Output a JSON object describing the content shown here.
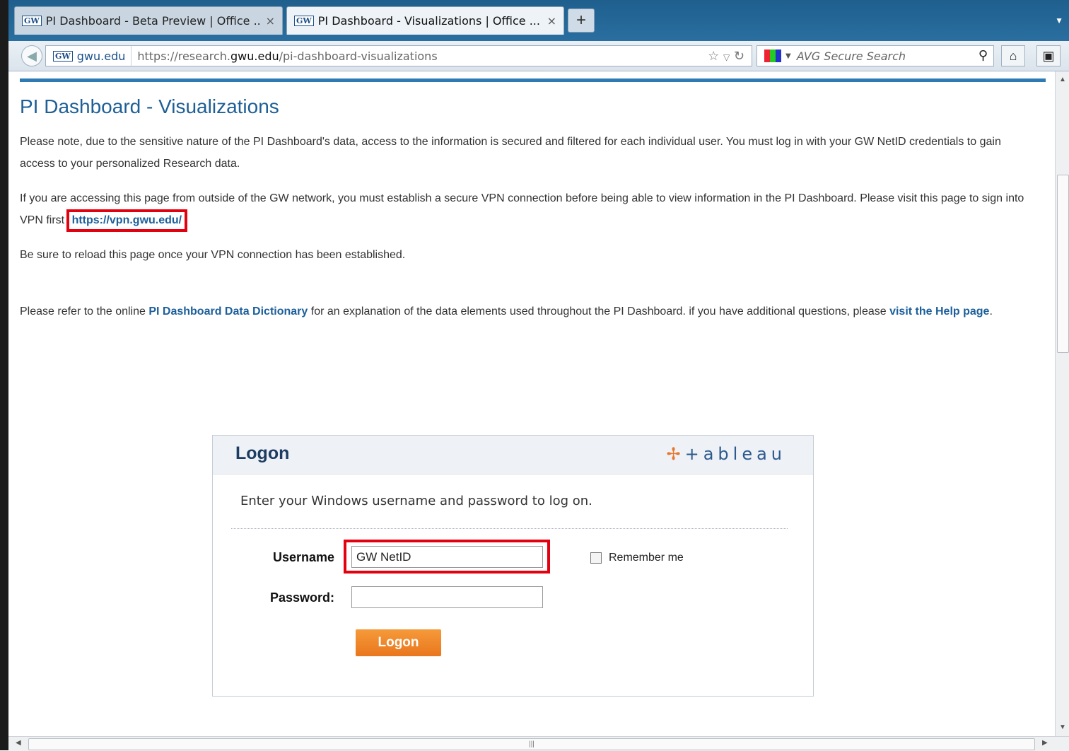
{
  "browser": {
    "tabs": [
      {
        "favicon": "GW",
        "title": "PI Dashboard - Beta Preview | Office ...",
        "close": "×"
      },
      {
        "favicon": "GW",
        "title": "PI Dashboard - Visualizations | Office ...",
        "close": "×"
      }
    ],
    "new_tab": "+",
    "site_identity": "gwu.edu",
    "url_prefix": "https://research.",
    "url_domain": "gwu.edu",
    "url_suffix": "/pi-dashboard-visualizations",
    "search_placeholder": "AVG Secure Search"
  },
  "page": {
    "title": "PI Dashboard - Visualizations",
    "p1": "Please note, due to the sensitive nature of the PI Dashboard's data, access to the information is secured and filtered for each individual user.  You must log in with your GW NetID credentials to gain access to your personalized Research data.",
    "p2_text": "If you are accessing this page from outside of the GW network, you must establish a secure VPN connection before being able to view information in the PI Dashboard.  Please visit this page to sign into VPN first",
    "vpn_link": "https://vpn.gwu.edu/",
    "p3": "Be sure to reload this page once your VPN connection has been established.",
    "p4_pre": "Please refer to the online ",
    "dictionary_link": "PI Dashboard Data Dictionary",
    "p4_mid": " for an explanation of the data elements used throughout the PI Dashboard.  if you have additional questions, please ",
    "help_link": "visit the Help page",
    "p4_post": "."
  },
  "logon": {
    "title": "Logon",
    "brand": "+ableau",
    "instruction": "Enter your Windows username and password to log on.",
    "username_label": "Username",
    "username_value": "GW NetID",
    "password_label": "Password:",
    "password_value": "",
    "remember_label": "Remember me",
    "remember_checked": false,
    "button_label": "Logon"
  },
  "colors": {
    "accent": "#1d5f96",
    "highlight": "#e3000f",
    "button": "#e9761d"
  }
}
